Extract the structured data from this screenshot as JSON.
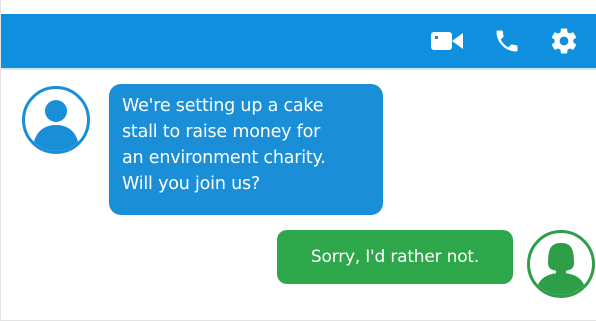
{
  "header": {
    "icons": [
      "video-camera-icon",
      "phone-icon",
      "settings-gear-icon"
    ]
  },
  "messages": [
    {
      "sender": "contact",
      "lines": [
        "We're setting up a cake",
        "stall to raise money for",
        "an environment charity.",
        "Will you join us?"
      ]
    },
    {
      "sender": "user",
      "text": "Sorry, I'd rather not."
    }
  ],
  "colors": {
    "header": "#0f8fdd",
    "incoming_bubble": "#1a8fd8",
    "outgoing_bubble": "#2ea74a",
    "text": "#ffffff"
  }
}
